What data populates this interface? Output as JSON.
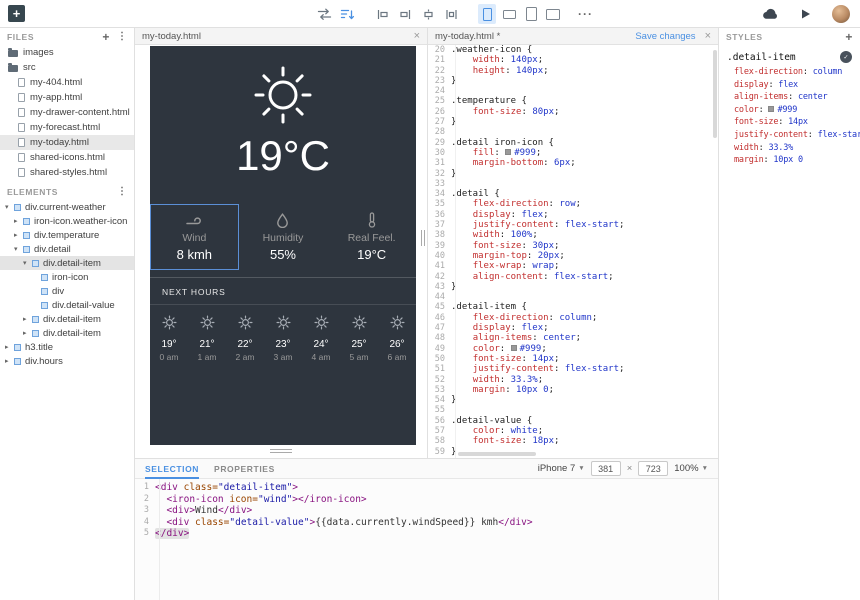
{
  "files_panel": {
    "header": "FILES",
    "items": [
      {
        "label": "images",
        "icon": "folder",
        "indent": 0,
        "selected": false
      },
      {
        "label": "src",
        "icon": "folder-open",
        "indent": 0,
        "selected": false
      },
      {
        "label": "my-404.html",
        "icon": "file",
        "indent": 1,
        "selected": false
      },
      {
        "label": "my-app.html",
        "icon": "file",
        "indent": 1,
        "selected": false
      },
      {
        "label": "my-drawer-content.html",
        "icon": "file",
        "indent": 1,
        "selected": false
      },
      {
        "label": "my-forecast.html",
        "icon": "file",
        "indent": 1,
        "selected": false
      },
      {
        "label": "my-today.html",
        "icon": "file",
        "indent": 1,
        "selected": true
      },
      {
        "label": "shared-icons.html",
        "icon": "file",
        "indent": 1,
        "selected": false
      },
      {
        "label": "shared-styles.html",
        "icon": "file",
        "indent": 1,
        "selected": false
      }
    ]
  },
  "elements_panel": {
    "header": "ELEMENTS",
    "items": [
      {
        "label": "div.current-weather",
        "indent": 0,
        "arrow": "down",
        "selected": false
      },
      {
        "label": "iron-icon.weather-icon",
        "indent": 1,
        "arrow": "right",
        "selected": false
      },
      {
        "label": "div.temperature",
        "indent": 1,
        "arrow": "right",
        "selected": false
      },
      {
        "label": "div.detail",
        "indent": 1,
        "arrow": "down",
        "selected": false
      },
      {
        "label": "div.detail-item",
        "indent": 2,
        "arrow": "down",
        "selected": true
      },
      {
        "label": "iron-icon",
        "indent": 3,
        "arrow": "none",
        "selected": false
      },
      {
        "label": "div",
        "indent": 3,
        "arrow": "none",
        "selected": false
      },
      {
        "label": "div.detail-value",
        "indent": 3,
        "arrow": "none",
        "selected": false
      },
      {
        "label": "div.detail-item",
        "indent": 2,
        "arrow": "right",
        "selected": false
      },
      {
        "label": "div.detail-item",
        "indent": 2,
        "arrow": "right",
        "selected": false
      },
      {
        "label": "h3.title",
        "indent": 0,
        "arrow": "right",
        "selected": false
      },
      {
        "label": "div.hours",
        "indent": 0,
        "arrow": "right",
        "selected": false
      }
    ]
  },
  "preview": {
    "tab_title": "my-today.html",
    "temperature": "19°C",
    "details": [
      {
        "icon": "wind-icon",
        "label": "Wind",
        "value": "8 kmh",
        "selected": true
      },
      {
        "icon": "humidity-icon",
        "label": "Humidity",
        "value": "55%",
        "selected": false
      },
      {
        "icon": "thermometer-icon",
        "label": "Real Feel.",
        "value": "19°C",
        "selected": false
      }
    ],
    "next_hours_label": "NEXT HOURS",
    "hours": [
      {
        "temp": "19°",
        "time": "0 am"
      },
      {
        "temp": "21°",
        "time": "1 am"
      },
      {
        "temp": "22°",
        "time": "2 am"
      },
      {
        "temp": "23°",
        "time": "3 am"
      },
      {
        "temp": "24°",
        "time": "4 am"
      },
      {
        "temp": "25°",
        "time": "5 am"
      },
      {
        "temp": "26°",
        "time": "6 am"
      }
    ]
  },
  "editor": {
    "tab_title": "my-today.html *",
    "save_label": "Save changes",
    "lines": [
      {
        "n": 20,
        "kind": "selector",
        "text": ".weather-icon {"
      },
      {
        "n": 21,
        "kind": "prop",
        "name": "width",
        "value": "140px"
      },
      {
        "n": 22,
        "kind": "prop",
        "name": "height",
        "value": "140px"
      },
      {
        "n": 23,
        "kind": "close"
      },
      {
        "n": 24,
        "kind": "blank"
      },
      {
        "n": 25,
        "kind": "selector",
        "text": ".temperature {"
      },
      {
        "n": 26,
        "kind": "prop",
        "name": "font-size",
        "value": "80px"
      },
      {
        "n": 27,
        "kind": "close"
      },
      {
        "n": 28,
        "kind": "blank"
      },
      {
        "n": 29,
        "kind": "selector",
        "text": ".detail iron-icon {"
      },
      {
        "n": 30,
        "kind": "prop",
        "name": "fill",
        "value": "#999",
        "swatch": "#999999"
      },
      {
        "n": 31,
        "kind": "prop",
        "name": "margin-bottom",
        "value": "6px"
      },
      {
        "n": 32,
        "kind": "close"
      },
      {
        "n": 33,
        "kind": "blank"
      },
      {
        "n": 34,
        "kind": "selector",
        "text": ".detail {"
      },
      {
        "n": 35,
        "kind": "prop",
        "name": "flex-direction",
        "value": "row"
      },
      {
        "n": 36,
        "kind": "prop",
        "name": "display",
        "value": "flex"
      },
      {
        "n": 37,
        "kind": "prop",
        "name": "justify-content",
        "value": "flex-start"
      },
      {
        "n": 38,
        "kind": "prop",
        "name": "width",
        "value": "100%"
      },
      {
        "n": 39,
        "kind": "prop",
        "name": "font-size",
        "value": "30px"
      },
      {
        "n": 40,
        "kind": "prop",
        "name": "margin-top",
        "value": "20px"
      },
      {
        "n": 41,
        "kind": "prop",
        "name": "flex-wrap",
        "value": "wrap"
      },
      {
        "n": 42,
        "kind": "prop",
        "name": "align-content",
        "value": "flex-start"
      },
      {
        "n": 43,
        "kind": "close"
      },
      {
        "n": 44,
        "kind": "blank"
      },
      {
        "n": 45,
        "kind": "selector",
        "text": ".detail-item {"
      },
      {
        "n": 46,
        "kind": "prop",
        "name": "flex-direction",
        "value": "column"
      },
      {
        "n": 47,
        "kind": "prop",
        "name": "display",
        "value": "flex"
      },
      {
        "n": 48,
        "kind": "prop",
        "name": "align-items",
        "value": "center"
      },
      {
        "n": 49,
        "kind": "prop",
        "name": "color",
        "value": "#999",
        "swatch": "#999999"
      },
      {
        "n": 50,
        "kind": "prop",
        "name": "font-size",
        "value": "14px"
      },
      {
        "n": 51,
        "kind": "prop",
        "name": "justify-content",
        "value": "flex-start"
      },
      {
        "n": 52,
        "kind": "prop",
        "name": "width",
        "value": "33.3%"
      },
      {
        "n": 53,
        "kind": "prop",
        "name": "margin",
        "value": "10px 0"
      },
      {
        "n": 54,
        "kind": "close"
      },
      {
        "n": 55,
        "kind": "blank"
      },
      {
        "n": 56,
        "kind": "selector",
        "text": ".detail-value {"
      },
      {
        "n": 57,
        "kind": "prop",
        "name": "color",
        "value": "white"
      },
      {
        "n": 58,
        "kind": "prop",
        "name": "font-size",
        "value": "18px"
      },
      {
        "n": 59,
        "kind": "close"
      }
    ]
  },
  "styles_panel": {
    "header": "STYLES",
    "selector": ".detail-item",
    "properties": [
      {
        "name": "flex-direction",
        "value": "column"
      },
      {
        "name": "display",
        "value": "flex"
      },
      {
        "name": "align-items",
        "value": "center"
      },
      {
        "name": "color",
        "value": "#999",
        "swatch": "#999999"
      },
      {
        "name": "font-size",
        "value": "14px"
      },
      {
        "name": "justify-content",
        "value": "flex-start"
      },
      {
        "name": "width",
        "value": "33.3%"
      },
      {
        "name": "margin",
        "value": "10px 0"
      }
    ]
  },
  "bottom_panel": {
    "tabs": [
      {
        "label": "SELECTION"
      },
      {
        "label": "PROPERTIES"
      }
    ],
    "device": {
      "name": "iPhone 7",
      "width": "381",
      "height": "723",
      "zoom": "100%"
    },
    "lines": [
      {
        "n": 1,
        "tokens": [
          {
            "t": "<div ",
            "c": "tag"
          },
          {
            "t": "class=",
            "c": "attr"
          },
          {
            "t": "\"detail-item\"",
            "c": "str"
          },
          {
            "t": ">",
            "c": "tag"
          }
        ]
      },
      {
        "n": 2,
        "tokens": [
          {
            "t": "  <iron-icon ",
            "c": "tag"
          },
          {
            "t": "icon=",
            "c": "attr"
          },
          {
            "t": "\"wind\"",
            "c": "str"
          },
          {
            "t": "></iron-icon>",
            "c": "tag"
          }
        ]
      },
      {
        "n": 3,
        "tokens": [
          {
            "t": "  <div>",
            "c": "tag"
          },
          {
            "t": "Wind",
            "c": "text"
          },
          {
            "t": "</div>",
            "c": "tag"
          }
        ]
      },
      {
        "n": 4,
        "tokens": [
          {
            "t": "  <div ",
            "c": "tag"
          },
          {
            "t": "class=",
            "c": "attr"
          },
          {
            "t": "\"detail-value\"",
            "c": "str"
          },
          {
            "t": ">",
            "c": "tag"
          },
          {
            "t": "{{data.currently.windSpeed}}",
            "c": "bind"
          },
          {
            "t": " kmh",
            "c": "text"
          },
          {
            "t": "</div>",
            "c": "tag"
          }
        ]
      },
      {
        "n": 5,
        "tokens": [
          {
            "t": "</div>",
            "c": "taghl"
          }
        ]
      }
    ]
  }
}
